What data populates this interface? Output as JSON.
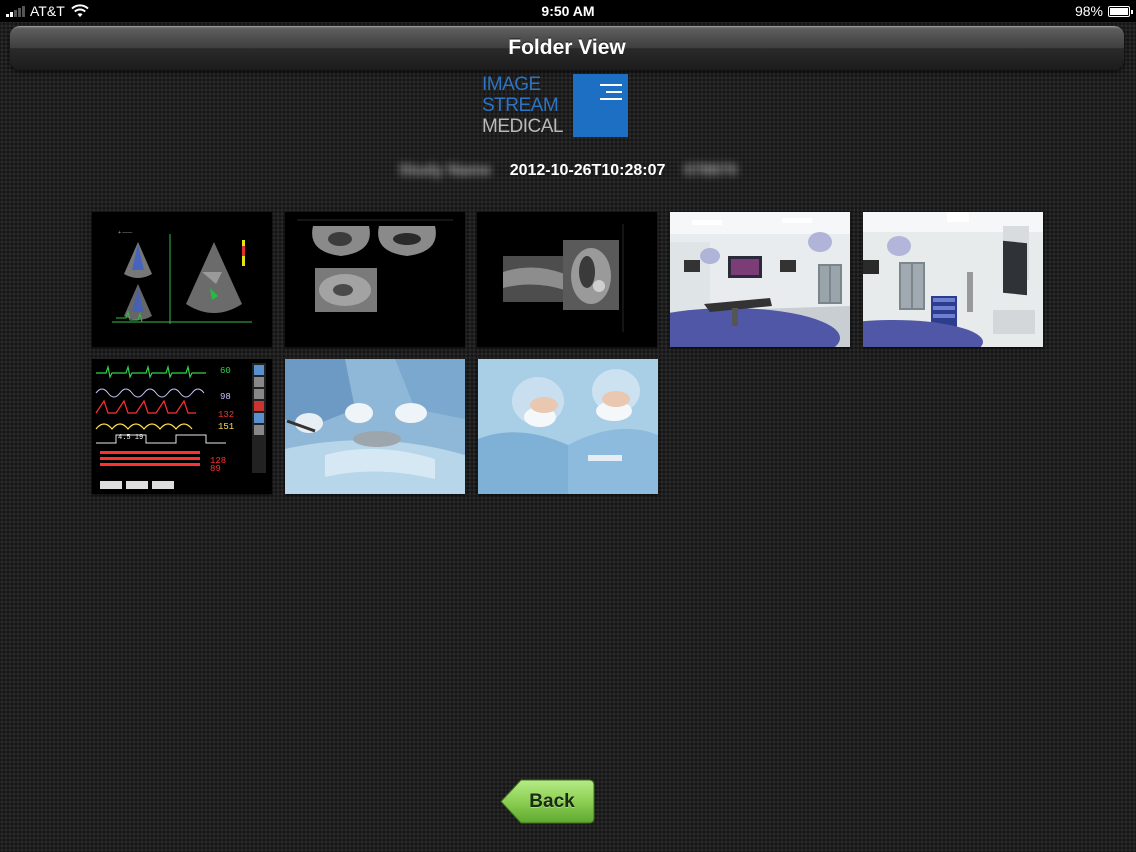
{
  "status_bar": {
    "carrier": "AT&T",
    "time": "9:50 AM",
    "battery": "98%",
    "battery_level": 0.98
  },
  "nav": {
    "title": "Folder View"
  },
  "logo": {
    "lines": [
      "IMAGE",
      "STREAM",
      "MEDICAL"
    ],
    "brand_color": "#1d6fc4"
  },
  "study": {
    "name_redacted": "Study Name",
    "timestamp": "2012-10-26T10:28:07",
    "id_redacted": "078970"
  },
  "thumbnails": [
    {
      "name": "echo-ultrasound"
    },
    {
      "name": "fetal-ultrasound"
    },
    {
      "name": "ultrasound-mri-split"
    },
    {
      "name": "operating-room-1"
    },
    {
      "name": "operating-room-2"
    },
    {
      "name": "vital-signs-monitor"
    },
    {
      "name": "surgery-hands"
    },
    {
      "name": "surgeons"
    }
  ],
  "back_button": {
    "label": "Back",
    "color": "#8ccf54"
  }
}
